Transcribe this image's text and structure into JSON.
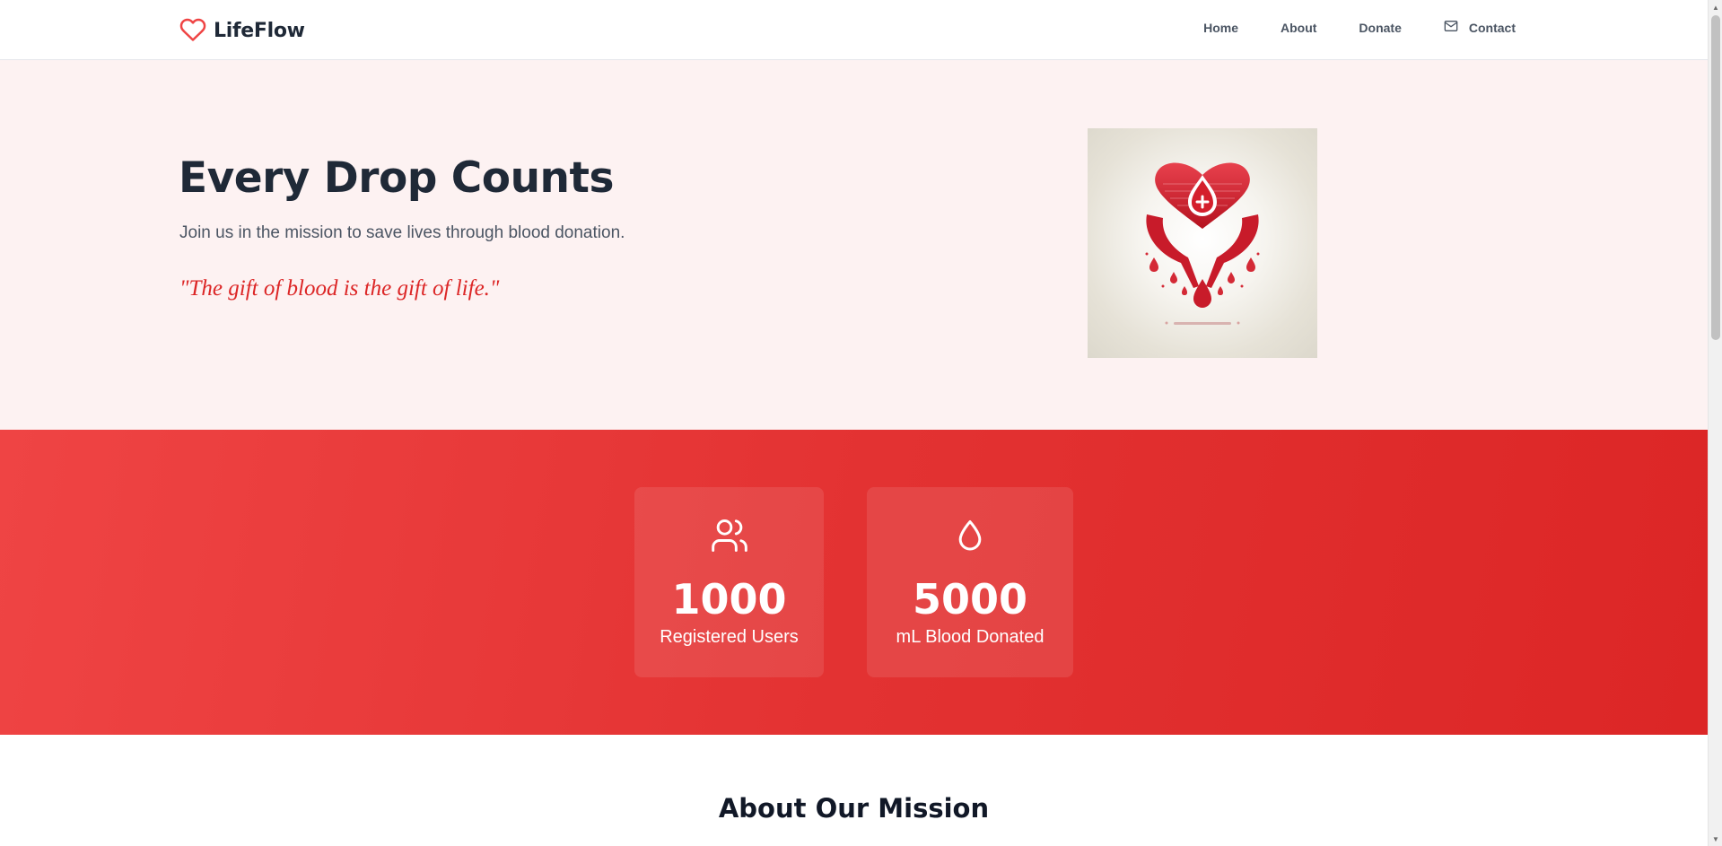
{
  "brand": {
    "name": "LifeFlow",
    "logo_icon": "heart-outline-icon",
    "accent_color": "#ef4444"
  },
  "nav": {
    "items": [
      {
        "label": "Home"
      },
      {
        "label": "About"
      },
      {
        "label": "Donate"
      },
      {
        "label": "Contact",
        "icon": "mail-icon"
      }
    ]
  },
  "hero": {
    "title": "Every Drop Counts",
    "subtitle": "Join us in the mission to save lives through blood donation.",
    "quote": "\"The gift of blood is the gift of life.\"",
    "image": "heart-in-hands-blood-drop-illustration",
    "background_color": "#fdf2f2",
    "quote_color": "#dc2626"
  },
  "stats": {
    "background_colors": [
      "#ef4444",
      "#dc2626"
    ],
    "items": [
      {
        "value": "1000",
        "label": "Registered Users",
        "icon": "users-icon"
      },
      {
        "value": "5000",
        "label": "mL Blood Donated",
        "icon": "droplet-icon"
      }
    ]
  },
  "about": {
    "title": "About Our Mission"
  }
}
